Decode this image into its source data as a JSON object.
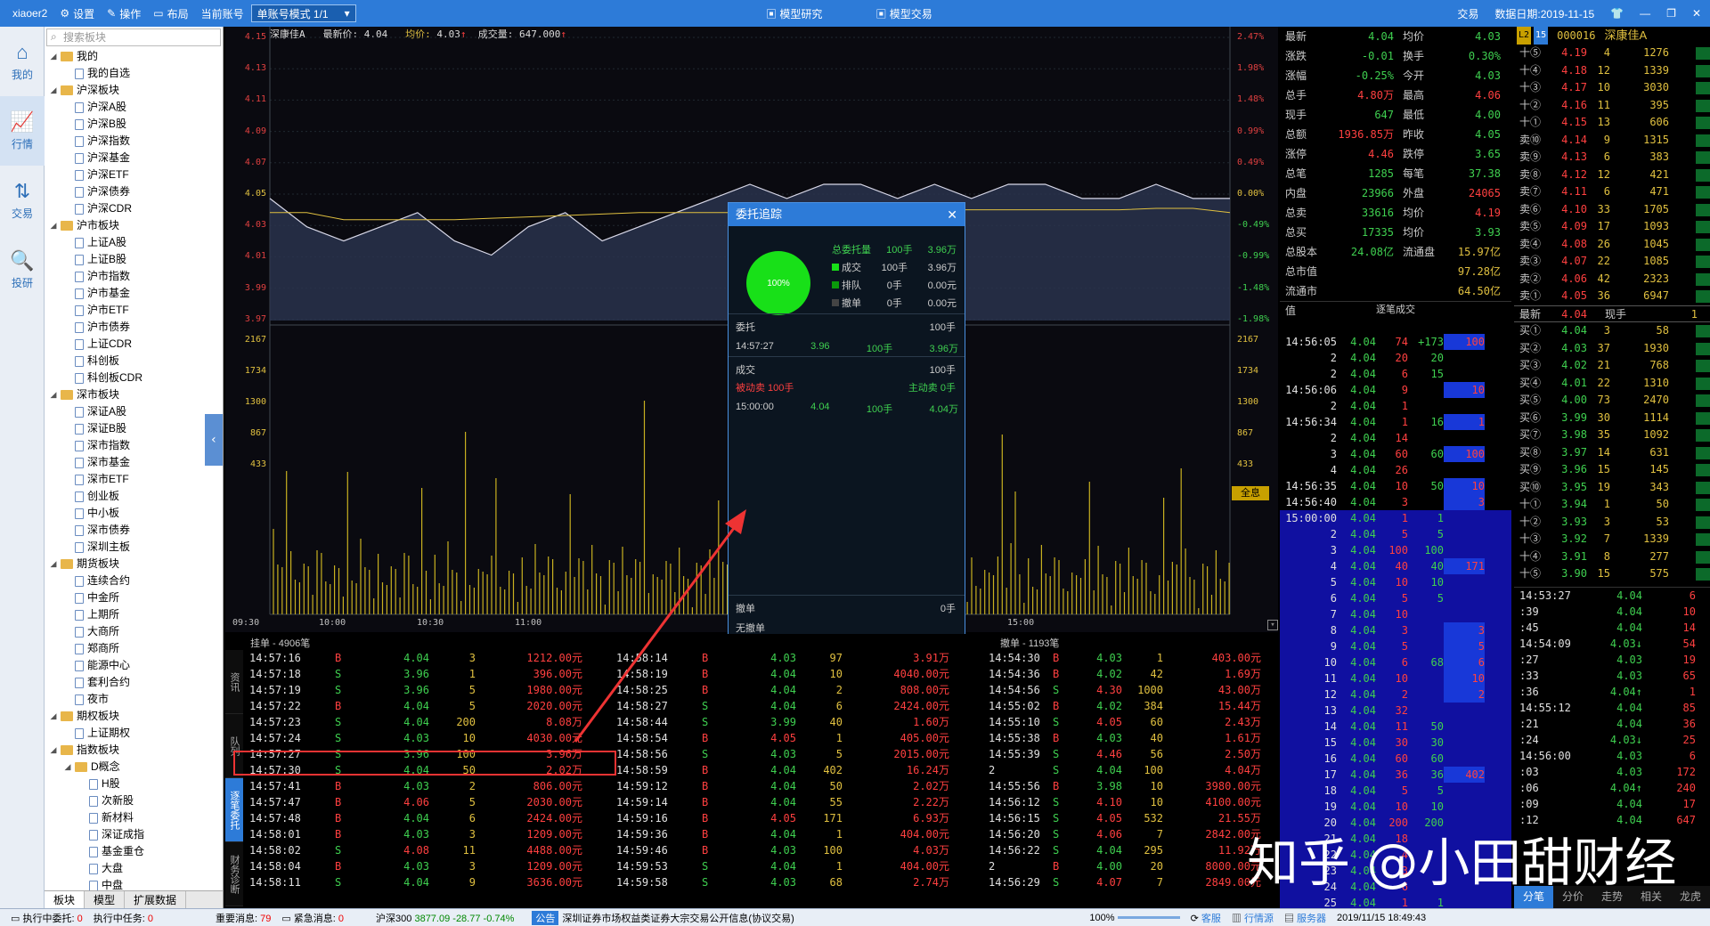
{
  "topbar": {
    "user": "xiaoer2",
    "settings": "设置",
    "operate": "操作",
    "layout": "布局",
    "account_label": "当前账号",
    "account_mode": "单账号模式 1/1",
    "model_research": "模型研究",
    "model_trade": "模型交易",
    "trade": "交易",
    "date": "数据日期:2019-11-15"
  },
  "leftnav": {
    "items": [
      {
        "label": "我的",
        "icon": "⌂"
      },
      {
        "label": "行情",
        "icon": "📈"
      },
      {
        "label": "交易",
        "icon": "⇅"
      },
      {
        "label": "投研",
        "icon": "🔍"
      }
    ]
  },
  "tree": {
    "search_placeholder": "搜索板块",
    "nodes": [
      {
        "label": "我的",
        "lvl": 0,
        "folder": true,
        "open": true
      },
      {
        "label": "我的自选",
        "lvl": 1
      },
      {
        "label": "沪深板块",
        "lvl": 0,
        "folder": true,
        "open": true
      },
      {
        "label": "沪深A股",
        "lvl": 1
      },
      {
        "label": "沪深B股",
        "lvl": 1
      },
      {
        "label": "沪深指数",
        "lvl": 1
      },
      {
        "label": "沪深基金",
        "lvl": 1
      },
      {
        "label": "沪深ETF",
        "lvl": 1
      },
      {
        "label": "沪深债券",
        "lvl": 1
      },
      {
        "label": "沪深CDR",
        "lvl": 1
      },
      {
        "label": "沪市板块",
        "lvl": 0,
        "folder": true,
        "open": true
      },
      {
        "label": "上证A股",
        "lvl": 1
      },
      {
        "label": "上证B股",
        "lvl": 1
      },
      {
        "label": "沪市指数",
        "lvl": 1
      },
      {
        "label": "沪市基金",
        "lvl": 1
      },
      {
        "label": "沪市ETF",
        "lvl": 1
      },
      {
        "label": "沪市债券",
        "lvl": 1
      },
      {
        "label": "上证CDR",
        "lvl": 1
      },
      {
        "label": "科创板",
        "lvl": 1
      },
      {
        "label": "科创板CDR",
        "lvl": 1
      },
      {
        "label": "深市板块",
        "lvl": 0,
        "folder": true,
        "open": true
      },
      {
        "label": "深证A股",
        "lvl": 1
      },
      {
        "label": "深证B股",
        "lvl": 1
      },
      {
        "label": "深市指数",
        "lvl": 1
      },
      {
        "label": "深市基金",
        "lvl": 1
      },
      {
        "label": "深市ETF",
        "lvl": 1
      },
      {
        "label": "创业板",
        "lvl": 1
      },
      {
        "label": "中小板",
        "lvl": 1
      },
      {
        "label": "深市债券",
        "lvl": 1
      },
      {
        "label": "深圳主板",
        "lvl": 1
      },
      {
        "label": "期货板块",
        "lvl": 0,
        "folder": true,
        "open": true
      },
      {
        "label": "连续合约",
        "lvl": 1
      },
      {
        "label": "中金所",
        "lvl": 1
      },
      {
        "label": "上期所",
        "lvl": 1
      },
      {
        "label": "大商所",
        "lvl": 1
      },
      {
        "label": "郑商所",
        "lvl": 1
      },
      {
        "label": "能源中心",
        "lvl": 1
      },
      {
        "label": "套利合约",
        "lvl": 1
      },
      {
        "label": "夜市",
        "lvl": 1
      },
      {
        "label": "期权板块",
        "lvl": 0,
        "folder": true,
        "open": true
      },
      {
        "label": "上证期权",
        "lvl": 1
      },
      {
        "label": "指数板块",
        "lvl": 0,
        "folder": true,
        "open": true
      },
      {
        "label": "D概念",
        "lvl": 1,
        "folder": true,
        "open": true
      },
      {
        "label": "H股",
        "lvl": 2
      },
      {
        "label": "次新股",
        "lvl": 2
      },
      {
        "label": "新材料",
        "lvl": 2
      },
      {
        "label": "深证成指",
        "lvl": 2
      },
      {
        "label": "基金重仓",
        "lvl": 2
      },
      {
        "label": "大盘",
        "lvl": 2
      },
      {
        "label": "中盘",
        "lvl": 2
      }
    ],
    "tabs": [
      "板块",
      "模型",
      "扩展数据"
    ]
  },
  "chart": {
    "name": "深康佳A",
    "last_label": "最新价:",
    "last": "4.04",
    "avg_label": "均价:",
    "avg": "4.03",
    "vol_label": "成交量:",
    "vol": "647.000",
    "y_left": [
      "4.15",
      "4.13",
      "4.11",
      "4.09",
      "4.07",
      "4.05",
      "4.03",
      "4.01",
      "3.99",
      "3.97"
    ],
    "y_right": [
      "2.47%",
      "1.98%",
      "1.48%",
      "0.99%",
      "0.49%",
      "0.00%",
      "-0.49%",
      "-0.99%",
      "-1.48%",
      "-1.98%"
    ],
    "vol_left": [
      "2167",
      "1734",
      "1300",
      "867",
      "433"
    ],
    "vol_right": [
      "2167",
      "1734",
      "1300",
      "867",
      "433"
    ],
    "x_ticks": [
      "09:30",
      "10:00",
      "10:30",
      "11:00",
      "14:00",
      "14:30",
      "15:00"
    ],
    "full_label": "全息"
  },
  "chart_data": {
    "type": "line",
    "title": "深康佳A",
    "series": [
      {
        "name": "价格",
        "values": [
          4.04,
          4.02,
          4.01,
          4.02,
          4.03,
          4.01,
          4.0,
          4.02,
          4.03,
          4.01,
          4.02,
          4.03,
          4.04,
          4.05,
          4.04,
          4.05,
          4.05,
          4.04,
          4.05,
          4.04,
          4.05,
          4.05,
          4.04,
          4.04,
          4.05,
          4.04,
          4.04
        ]
      },
      {
        "name": "均价",
        "values": [
          4.03,
          4.03,
          4.025,
          4.025,
          4.025,
          4.025,
          4.026,
          4.027,
          4.028,
          4.029,
          4.03,
          4.03,
          4.03,
          4.03,
          4.03,
          4.031,
          4.031,
          4.031,
          4.032,
          4.032,
          4.032,
          4.032,
          4.032,
          4.032,
          4.033,
          4.033,
          4.03
        ]
      }
    ],
    "ylim": [
      3.96,
      4.16
    ]
  },
  "popup": {
    "title": "委托追踪",
    "pct": "100%",
    "total_label": "总委托量",
    "total_qty": "100手",
    "total_amt": "3.96万",
    "legend": [
      {
        "label": "成交",
        "qty": "100手",
        "amt": "3.96万",
        "color": "#18e018"
      },
      {
        "label": "排队",
        "qty": "0手",
        "amt": "0.00元",
        "color": "#0a9a0a"
      },
      {
        "label": "撤单",
        "qty": "0手",
        "amt": "0.00元",
        "color": "#444"
      }
    ],
    "entrust_label": "委托",
    "entrust_qty": "100手",
    "entrust_time": "14:57:27",
    "entrust_price": "3.96",
    "entrust_lots": "100手",
    "entrust_amt": "3.96万",
    "deal_label": "成交",
    "deal_qty": "100手",
    "passive": "被动卖 100手",
    "active": "主动卖 0手",
    "deal_time": "15:00:00",
    "deal_price": "4.04",
    "deal_lots": "100手",
    "deal_amt": "4.04万",
    "cancel_label": "撤单",
    "cancel_qty": "0手",
    "no_cancel": "无撤单"
  },
  "orders": {
    "left_title": "挂单 - 4906笔",
    "right_title": "撤单 - 1193笔",
    "side_tabs": [
      "资讯",
      "队列",
      "逐笔委托",
      "财务诊断"
    ],
    "col1": [
      [
        "14:57:16",
        "B",
        "4.04",
        "3",
        "1212.00元"
      ],
      [
        "14:57:18",
        "S",
        "3.96",
        "1",
        "396.00元"
      ],
      [
        "14:57:19",
        "S",
        "3.96",
        "5",
        "1980.00元"
      ],
      [
        "14:57:22",
        "B",
        "4.04",
        "5",
        "2020.00元"
      ],
      [
        "14:57:23",
        "S",
        "4.04",
        "200",
        "8.08万"
      ],
      [
        "14:57:24",
        "S",
        "4.03",
        "10",
        "4030.00元"
      ],
      [
        "14:57:27",
        "S",
        "3.96",
        "100",
        "3.96万"
      ],
      [
        "14:57:30",
        "S",
        "4.04",
        "50",
        "2.02万"
      ],
      [
        "14:57:41",
        "B",
        "4.03",
        "2",
        "806.00元"
      ],
      [
        "14:57:47",
        "B",
        "4.06",
        "5",
        "2030.00元"
      ],
      [
        "14:57:48",
        "B",
        "4.04",
        "6",
        "2424.00元"
      ],
      [
        "14:58:01",
        "B",
        "4.03",
        "3",
        "1209.00元"
      ],
      [
        "14:58:02",
        "S",
        "4.08",
        "11",
        "4488.00元"
      ],
      [
        "14:58:04",
        "B",
        "4.03",
        "3",
        "1209.00元"
      ],
      [
        "14:58:11",
        "S",
        "4.04",
        "9",
        "3636.00元"
      ]
    ],
    "col2": [
      [
        "14:58:14",
        "B",
        "4.03",
        "97",
        "3.91万"
      ],
      [
        "14:58:19",
        "B",
        "4.04",
        "10",
        "4040.00元"
      ],
      [
        "14:58:25",
        "B",
        "4.04",
        "2",
        "808.00元"
      ],
      [
        "14:58:27",
        "S",
        "4.04",
        "6",
        "2424.00元"
      ],
      [
        "14:58:44",
        "S",
        "3.99",
        "40",
        "1.60万"
      ],
      [
        "14:58:54",
        "B",
        "4.05",
        "1",
        "405.00元"
      ],
      [
        "14:58:56",
        "S",
        "4.03",
        "5",
        "2015.00元"
      ],
      [
        "14:58:59",
        "B",
        "4.04",
        "402",
        "16.24万"
      ],
      [
        "14:59:12",
        "B",
        "4.04",
        "50",
        "2.02万"
      ],
      [
        "14:59:14",
        "B",
        "4.04",
        "55",
        "2.22万"
      ],
      [
        "14:59:16",
        "B",
        "4.05",
        "171",
        "6.93万"
      ],
      [
        "14:59:36",
        "B",
        "4.04",
        "1",
        "404.00元"
      ],
      [
        "14:59:46",
        "B",
        "4.03",
        "100",
        "4.03万"
      ],
      [
        "14:59:53",
        "S",
        "4.04",
        "1",
        "404.00元"
      ],
      [
        "14:59:58",
        "S",
        "4.03",
        "68",
        "2.74万"
      ]
    ],
    "col3": [
      [
        "14:54:30",
        "B",
        "4.03",
        "1",
        "403.00元"
      ],
      [
        "14:54:36",
        "B",
        "4.02",
        "42",
        "1.69万"
      ],
      [
        "14:54:56",
        "S",
        "4.30",
        "1000",
        "43.00万"
      ],
      [
        "14:55:02",
        "B",
        "4.02",
        "384",
        "15.44万"
      ],
      [
        "14:55:10",
        "S",
        "4.05",
        "60",
        "2.43万"
      ],
      [
        "14:55:38",
        "B",
        "4.03",
        "40",
        "1.61万"
      ],
      [
        "14:55:39",
        "S",
        "4.46",
        "56",
        "2.50万"
      ],
      [
        "2",
        "S",
        "4.04",
        "100",
        "4.04万"
      ],
      [
        "14:55:56",
        "B",
        "3.98",
        "10",
        "3980.00元"
      ],
      [
        "14:56:12",
        "S",
        "4.10",
        "10",
        "4100.00元"
      ],
      [
        "14:56:15",
        "S",
        "4.05",
        "532",
        "21.55万"
      ],
      [
        "14:56:20",
        "S",
        "4.06",
        "7",
        "2842.00元"
      ],
      [
        "14:56:22",
        "S",
        "4.04",
        "295",
        "11.92万"
      ],
      [
        "2",
        "B",
        "4.00",
        "20",
        "8000.00元"
      ],
      [
        "14:56:29",
        "S",
        "4.07",
        "7",
        "2849.00元"
      ]
    ]
  },
  "quote": {
    "rows": [
      [
        "最新",
        "4.04",
        "均价",
        "4.03"
      ],
      [
        "涨跌",
        "-0.01",
        "换手",
        "0.30%"
      ],
      [
        "涨幅",
        "-0.25%",
        "今开",
        "4.03"
      ],
      [
        "总手",
        "4.80万",
        "最高",
        "4.06"
      ],
      [
        "现手",
        "647",
        "最低",
        "4.00"
      ],
      [
        "总额",
        "1936.85万",
        "昨收",
        "4.05"
      ],
      [
        "涨停",
        "4.46",
        "跌停",
        "3.65"
      ],
      [
        "总笔",
        "1285",
        "每笔",
        "37.38"
      ],
      [
        "内盘",
        "23966",
        "外盘",
        "24065"
      ],
      [
        "总卖",
        "33616",
        "均价",
        "4.19"
      ],
      [
        "总买",
        "17335",
        "均价",
        "3.93"
      ],
      [
        "总股本",
        "24.08亿",
        "流通盘",
        "15.97亿"
      ],
      [
        "总市值",
        "",
        "",
        "97.28亿"
      ],
      [
        "流通市值",
        "",
        "",
        "64.50亿"
      ]
    ],
    "ticks_title": "逐笔成交"
  },
  "ticks": [
    [
      "14:56:05",
      "4.04",
      "74",
      "+173",
      "100"
    ],
    [
      "2",
      "4.04",
      "20",
      "20",
      ""
    ],
    [
      "2",
      "4.04",
      "6",
      "15",
      ""
    ],
    [
      "14:56:06",
      "4.04",
      "9",
      "",
      "10"
    ],
    [
      "2",
      "4.04",
      "1",
      "",
      ""
    ],
    [
      "14:56:34",
      "4.04",
      "1",
      "16",
      "1"
    ],
    [
      "2",
      "4.04",
      "14",
      "",
      ""
    ],
    [
      "3",
      "4.04",
      "60",
      "60",
      "100"
    ],
    [
      "4",
      "4.04",
      "26",
      "",
      ""
    ],
    [
      "14:56:35",
      "4.04",
      "10",
      "50",
      "10"
    ],
    [
      "14:56:40",
      "4.04",
      "3",
      "",
      "3"
    ],
    [
      "15:00:00",
      "4.04",
      "1",
      "1",
      ""
    ],
    [
      "2",
      "4.04",
      "5",
      "5",
      ""
    ],
    [
      "3",
      "4.04",
      "100",
      "100",
      ""
    ],
    [
      "4",
      "4.04",
      "40",
      "40",
      "171"
    ],
    [
      "5",
      "4.04",
      "10",
      "10",
      ""
    ],
    [
      "6",
      "4.04",
      "5",
      "5",
      ""
    ],
    [
      "7",
      "4.04",
      "10",
      "",
      ""
    ],
    [
      "8",
      "4.04",
      "3",
      "",
      "3"
    ],
    [
      "9",
      "4.04",
      "5",
      "",
      "5"
    ],
    [
      "10",
      "4.04",
      "6",
      "68",
      "6"
    ],
    [
      "11",
      "4.04",
      "10",
      "",
      "10"
    ],
    [
      "12",
      "4.04",
      "2",
      "",
      "2"
    ],
    [
      "13",
      "4.04",
      "32",
      "",
      ""
    ],
    [
      "14",
      "4.04",
      "11",
      "50",
      ""
    ],
    [
      "15",
      "4.04",
      "30",
      "30",
      ""
    ],
    [
      "16",
      "4.04",
      "60",
      "60",
      ""
    ],
    [
      "17",
      "4.04",
      "36",
      "36",
      "402"
    ],
    [
      "18",
      "4.04",
      "5",
      "5",
      ""
    ],
    [
      "19",
      "4.04",
      "10",
      "10",
      ""
    ],
    [
      "20",
      "4.04",
      "200",
      "200",
      ""
    ],
    [
      "21",
      "4.04",
      "18",
      "",
      ""
    ],
    [
      "22",
      "4.04",
      "4",
      "",
      ""
    ],
    [
      "23",
      "4.04",
      "3",
      "",
      ""
    ],
    [
      "24",
      "4.04",
      "6",
      "",
      ""
    ],
    [
      "25",
      "4.04",
      "1",
      "1",
      ""
    ]
  ],
  "book": {
    "code": "000016",
    "name": "深康佳A",
    "sells": [
      [
        "十⑤",
        "4.19",
        "4",
        "1276"
      ],
      [
        "十④",
        "4.18",
        "12",
        "1339"
      ],
      [
        "十③",
        "4.17",
        "10",
        "3030"
      ],
      [
        "十②",
        "4.16",
        "11",
        "395"
      ],
      [
        "十①",
        "4.15",
        "13",
        "606"
      ],
      [
        "卖⑩",
        "4.14",
        "9",
        "1315"
      ],
      [
        "卖⑨",
        "4.13",
        "6",
        "383"
      ],
      [
        "卖⑧",
        "4.12",
        "12",
        "421"
      ],
      [
        "卖⑦",
        "4.11",
        "6",
        "471"
      ],
      [
        "卖⑥",
        "4.10",
        "33",
        "1705"
      ],
      [
        "卖⑤",
        "4.09",
        "17",
        "1093"
      ],
      [
        "卖④",
        "4.08",
        "26",
        "1045"
      ],
      [
        "卖③",
        "4.07",
        "22",
        "1085"
      ],
      [
        "卖②",
        "4.06",
        "42",
        "2323"
      ],
      [
        "卖①",
        "4.05",
        "36",
        "6947"
      ]
    ],
    "mid": [
      "最新",
      "4.04",
      "现手",
      "1"
    ],
    "buys": [
      [
        "买①",
        "4.04",
        "3",
        "58"
      ],
      [
        "买②",
        "4.03",
        "37",
        "1930"
      ],
      [
        "买③",
        "4.02",
        "21",
        "768"
      ],
      [
        "买④",
        "4.01",
        "22",
        "1310"
      ],
      [
        "买⑤",
        "4.00",
        "73",
        "2470"
      ],
      [
        "买⑥",
        "3.99",
        "30",
        "1114"
      ],
      [
        "买⑦",
        "3.98",
        "35",
        "1092"
      ],
      [
        "买⑧",
        "3.97",
        "14",
        "631"
      ],
      [
        "买⑨",
        "3.96",
        "15",
        "145"
      ],
      [
        "买⑩",
        "3.95",
        "19",
        "343"
      ],
      [
        "十①",
        "3.94",
        "1",
        "50"
      ],
      [
        "十②",
        "3.93",
        "3",
        "53"
      ],
      [
        "十③",
        "3.92",
        "7",
        "1339"
      ],
      [
        "十④",
        "3.91",
        "8",
        "277"
      ],
      [
        "十⑤",
        "3.90",
        "15",
        "575"
      ]
    ],
    "trades": [
      [
        "14:53:27",
        "4.04",
        "6"
      ],
      [
        ":39",
        "4.04",
        "10"
      ],
      [
        ":45",
        "4.04",
        "14"
      ],
      [
        "14:54:09",
        "4.03↓",
        "54"
      ],
      [
        ":27",
        "4.03",
        "19"
      ],
      [
        ":33",
        "4.03",
        "65"
      ],
      [
        ":36",
        "4.04↑",
        "1"
      ],
      [
        "14:55:12",
        "4.04",
        "85"
      ],
      [
        ":21",
        "4.04",
        "36"
      ],
      [
        ":24",
        "4.03↓",
        "25"
      ],
      [
        "14:56:00",
        "4.03",
        "6"
      ],
      [
        ":03",
        "4.03",
        "172"
      ],
      [
        ":06",
        "4.04↑",
        "240"
      ],
      [
        ":09",
        "4.04",
        "17"
      ],
      [
        ":12",
        "4.04",
        "647"
      ]
    ],
    "tabs": [
      "分笔",
      "分价",
      "走势",
      "相关",
      "龙虎"
    ]
  },
  "status": {
    "exec_entrust": "执行中委托:",
    "exec_entrust_n": "0",
    "exec_task": "执行中任务:",
    "exec_task_n": "0",
    "important": "重要消息:",
    "important_n": "79",
    "urgent": "紧急消息:",
    "urgent_n": "0",
    "index": "沪深300",
    "index_val": "3877.09",
    "index_chg": "-28.77",
    "index_pct": "-0.74%",
    "notice_label": "公告",
    "notice": "深圳证券市场权益类证券大宗交易公开信息(协议交易)",
    "zoom": "100%",
    "service": "客服",
    "market_src": "行情源",
    "server": "服务器",
    "datetime": "2019/11/15 18:49:43"
  },
  "watermark": "知乎 @小田甜财经"
}
